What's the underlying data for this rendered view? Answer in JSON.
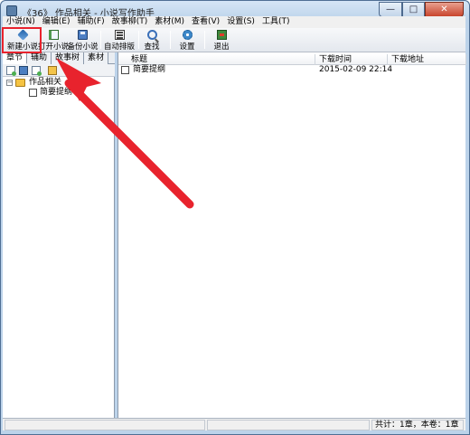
{
  "window": {
    "title": "《36》 作品相关 - 小说写作助手"
  },
  "menu": {
    "items": [
      "小说(N)",
      "编辑(E)",
      "辅助(F)",
      "故事柳(T)",
      "素材(M)",
      "查看(V)",
      "设置(S)",
      "工具(T)"
    ]
  },
  "toolbar": {
    "buttons": [
      {
        "label": "新建小说",
        "icon": "new-novel-icon"
      },
      {
        "label": "打开小说",
        "icon": "open-novel-icon"
      },
      {
        "label": "备份小说",
        "icon": "backup-novel-icon"
      },
      {
        "label": "自动排版",
        "icon": "auto-layout-icon"
      },
      {
        "label": "查找",
        "icon": "find-icon"
      },
      {
        "label": "设置",
        "icon": "settings-icon"
      },
      {
        "label": "退出",
        "icon": "exit-icon"
      }
    ]
  },
  "left_panel": {
    "tabs": [
      "章节",
      "辅助",
      "故事树",
      "素材"
    ],
    "active_tab": "章节",
    "tree": {
      "root": "作品相关",
      "children": [
        "简要提纲"
      ]
    }
  },
  "list": {
    "columns": [
      "标题",
      "下载时间",
      "下载地址"
    ],
    "rows": [
      {
        "title": "简要提纲",
        "time": "2015-02-09 22:14",
        "url": ""
      }
    ]
  },
  "statusbar": {
    "count": "共计：1章，本卷：1章"
  },
  "colors": {
    "annotation": "#e8232d",
    "titlebar": "#bcd3ea"
  }
}
